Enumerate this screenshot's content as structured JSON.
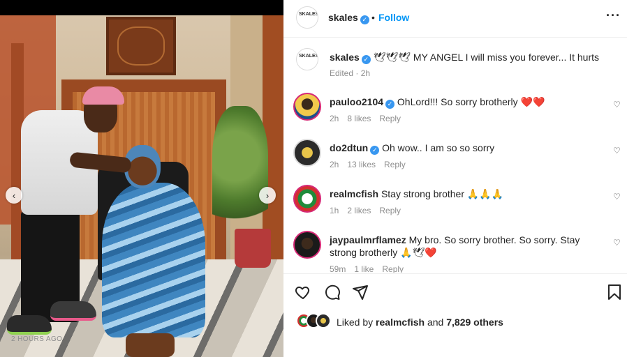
{
  "header": {
    "username": "skales",
    "verified_glyph": "✓",
    "separator": "•",
    "follow_label": "Follow",
    "more_label": "···",
    "avatar_text": "SKALES"
  },
  "caption": {
    "username": "skales",
    "text": "🕊🕊🕊 MY ANGEL I will miss you forever... It hurts",
    "edited": "Edited · 2h"
  },
  "comments": [
    {
      "username": "pauloo2104",
      "verified": true,
      "text": "OhLord!!! So sorry brotherly ❤️❤️",
      "time": "2h",
      "likes": "8 likes",
      "reply": "Reply"
    },
    {
      "username": "do2dtun",
      "verified": true,
      "text": "Oh wow.. I am so so sorry",
      "time": "2h",
      "likes": "13 likes",
      "reply": "Reply"
    },
    {
      "username": "realmcfish",
      "verified": false,
      "text": "Stay strong brother 🙏🙏🙏",
      "time": "1h",
      "likes": "2 likes",
      "reply": "Reply"
    },
    {
      "username": "jaypaulmrflamez",
      "verified": false,
      "text": "My bro. So sorry brother. So sorry. Stay strong brotherly 🙏🕊❤️",
      "time": "59m",
      "likes": "1 like",
      "reply": "Reply"
    }
  ],
  "likes": {
    "prefix": "Liked by ",
    "user": "realmcfish",
    "middle": " and ",
    "count": "7,829 others"
  },
  "timestamp": "2 HOURS AGO",
  "icons": {
    "heart": "heart-icon",
    "comment": "comment-icon",
    "share": "share-icon",
    "save": "bookmark-icon",
    "prev": "chevron-left-icon",
    "next": "chevron-right-icon"
  },
  "nav": {
    "prev_glyph": "‹",
    "next_glyph": "›",
    "heart_glyph": "♡"
  },
  "colors": {
    "follow": "#0095f6",
    "verified": "#3897f0",
    "meta": "#8e8e8e"
  }
}
